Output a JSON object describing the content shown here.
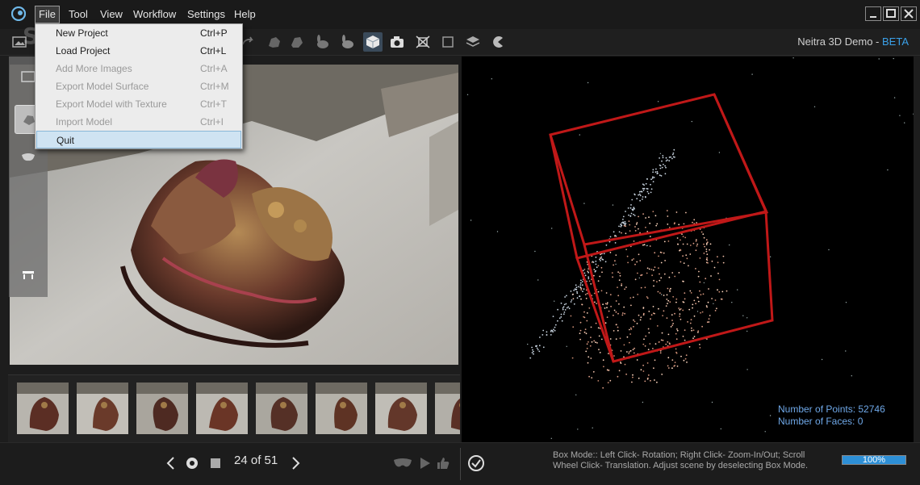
{
  "menubar": {
    "items": [
      "File",
      "Tool",
      "View",
      "Workflow",
      "Settings",
      "Help"
    ]
  },
  "watermark": "SOFTPEDIA",
  "watermark_mark": "®",
  "product": {
    "name": "Neitra 3D Demo - ",
    "badge": "BETA"
  },
  "file_menu": {
    "items": [
      {
        "label": "New Project",
        "shortcut": "Ctrl+P",
        "enabled": true
      },
      {
        "label": "Load Project",
        "shortcut": "Ctrl+L",
        "enabled": true
      },
      {
        "label": "Add More Images",
        "shortcut": "Ctrl+A",
        "enabled": false
      },
      {
        "label": "Export Model Surface",
        "shortcut": "Ctrl+M",
        "enabled": false
      },
      {
        "label": "Export Model with Texture",
        "shortcut": "Ctrl+T",
        "enabled": false
      },
      {
        "label": "Import Model",
        "shortcut": "Ctrl+I",
        "enabled": false
      },
      {
        "label": "Quit",
        "shortcut": "",
        "enabled": true,
        "highlighted": true
      }
    ]
  },
  "toolbar_icons": [
    "image-icon",
    "undo-icon",
    "redo-icon",
    "sculpt-icon",
    "texture-icon",
    "rabbit-icon",
    "rabbit-smooth-icon",
    "cube-icon",
    "camera-icon",
    "crop-icon",
    "square-icon",
    "layers-icon",
    "pacman-icon"
  ],
  "navigation": {
    "counter": "24 of 51",
    "current": 24,
    "total": 51
  },
  "viewport": {
    "points_label": "Number of Points: 52746",
    "faces_label": "Number of Faces: 0",
    "box_color": "#c01818"
  },
  "status": {
    "hint": "Box Mode:: Left Click- Rotation; Right Click- Zoom-In/Out; Scroll Wheel Click- Translation. Adjust scene by deselecting Box Mode.",
    "progress_label": "100%",
    "progress_value": 1.0
  },
  "colors": {
    "accent": "#3aa0e8",
    "progress": "#2d8fd6",
    "menu_highlight": "#cfe3f2"
  }
}
